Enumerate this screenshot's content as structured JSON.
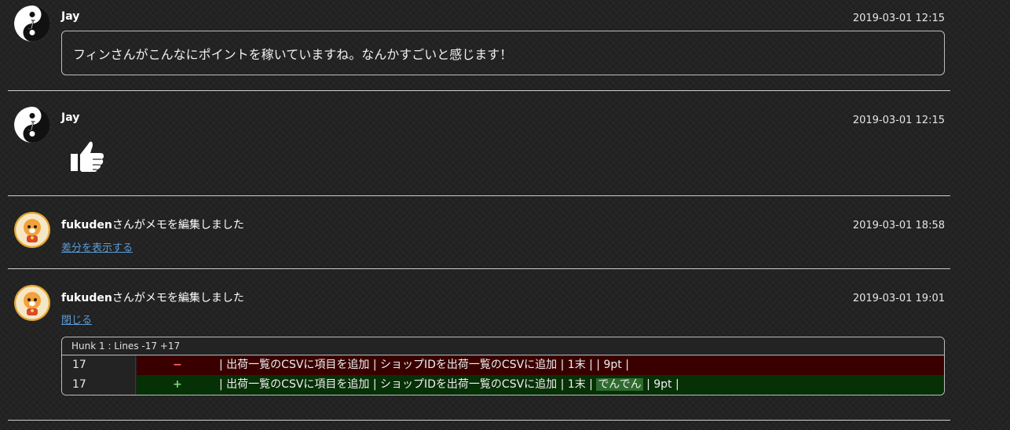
{
  "feed": {
    "entries": [
      {
        "author": "Jay",
        "timestamp": "2019-03-01 12:15",
        "message": "フィンさんがこんなにポイントを稼いていますね。なんかすごいと感じます！"
      },
      {
        "author": "Jay",
        "timestamp": "2019-03-01 12:15",
        "reaction_icon": "thumbs-up-icon"
      },
      {
        "author": "fukuden",
        "action": "さんがメモを編集しました",
        "timestamp": "2019-03-01 18:58",
        "link": "差分を表示する"
      },
      {
        "author": "fukuden",
        "action": "さんがメモを編集しました",
        "timestamp": "2019-03-01 19:01",
        "link": "閉じる",
        "diff": {
          "hunk_header": "Hunk 1 : Lines -17 +17",
          "removed": {
            "line": "17",
            "sign": "−",
            "text": "| 出荷一覧のCSVに項目を追加 | ショップIDを出荷一覧のCSVに追加 | 1末 |  | 9pt |"
          },
          "added": {
            "line": "17",
            "sign": "+",
            "text_before": "| 出荷一覧のCSVに項目を追加 | ショップIDを出荷一覧のCSVに追加 | 1末 | ",
            "text_highlight": "でんでん",
            "text_after": " | 9pt |"
          }
        }
      }
    ]
  },
  "colors": {
    "background": "#232323",
    "link": "#5b9bd5",
    "diff_removed_bg": "#3a0000",
    "diff_added_bg": "#063006",
    "diff_highlight_bg": "#2f6a2f"
  }
}
